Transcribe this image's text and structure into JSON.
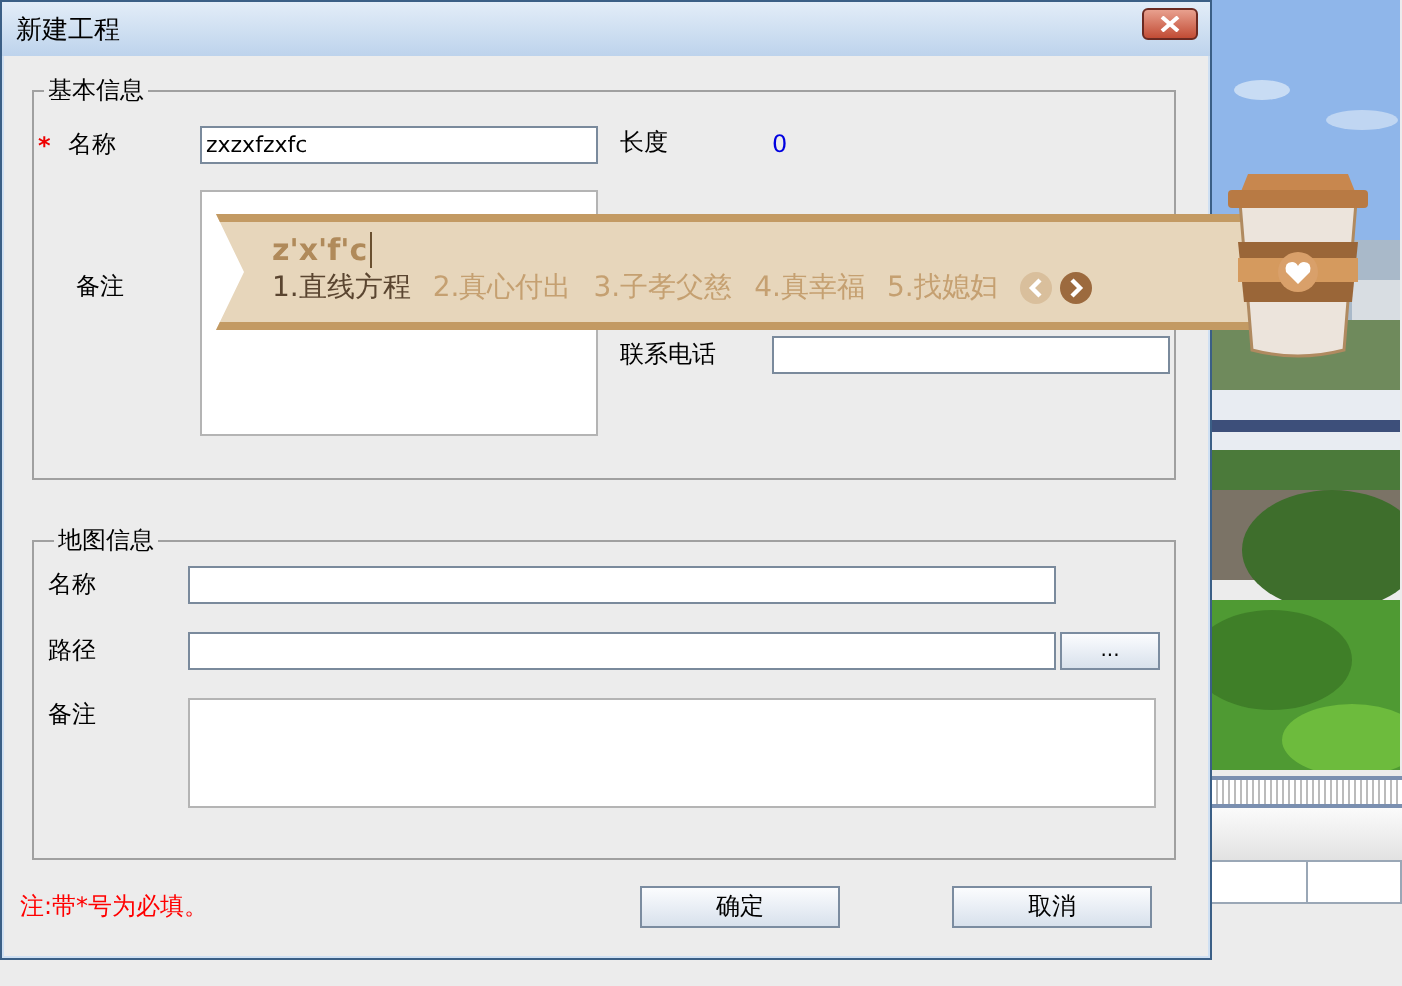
{
  "window": {
    "title": "新建工程"
  },
  "basic_info": {
    "title": "基本信息",
    "name": {
      "required_mark": "*",
      "label": "名称",
      "value": "zxzxfzxfc"
    },
    "length": {
      "label": "长度",
      "value": "0"
    },
    "remark": {
      "label": "备注"
    },
    "phone": {
      "label": "联系电话"
    }
  },
  "map_info": {
    "title": "地图信息",
    "name": {
      "label": "名称"
    },
    "path": {
      "label": "路径",
      "browse_button": "..."
    },
    "remark": {
      "label": "备注"
    }
  },
  "note": "注:带*号为必填。",
  "buttons": [
    {
      "label": "确定"
    },
    {
      "label": "取消"
    }
  ],
  "ime": {
    "composition": "z'x'f'c",
    "candidates": [
      {
        "text": "1.直线方程",
        "selected": true
      },
      {
        "text": "2.真心付出",
        "selected": false
      },
      {
        "text": "3.子孝父慈",
        "selected": false
      },
      {
        "text": "4.真幸福",
        "selected": false
      },
      {
        "text": "5.找媳妇",
        "selected": false
      }
    ],
    "prev_enabled": false,
    "next_enabled": true
  }
}
